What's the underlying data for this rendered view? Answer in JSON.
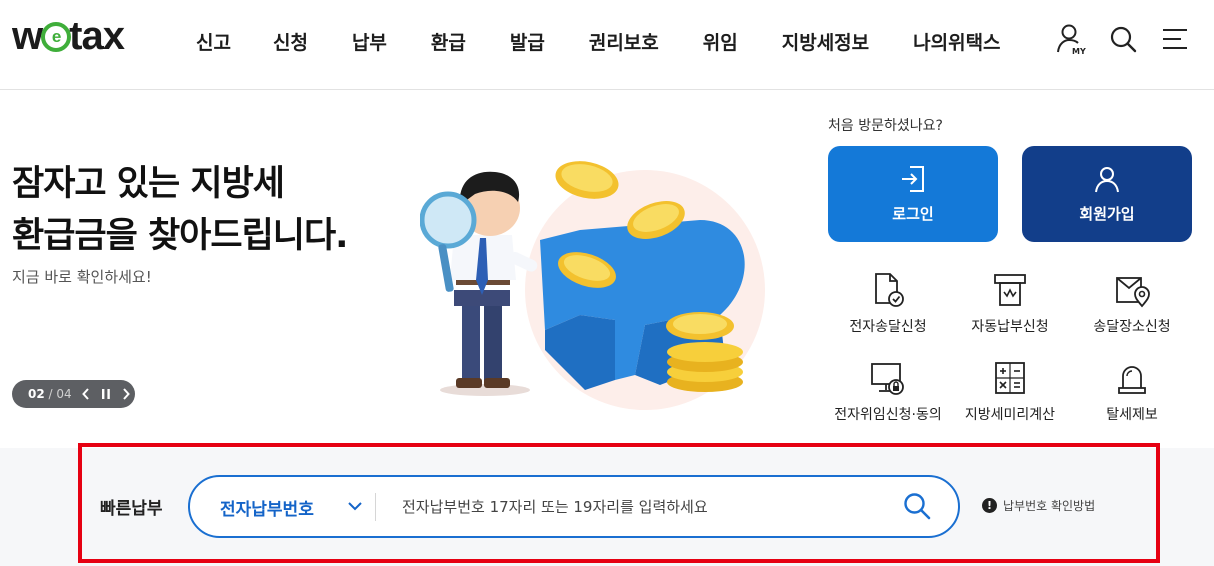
{
  "logo": {
    "pre": "w",
    "mid": "e",
    "post": "tax"
  },
  "nav": [
    "신고",
    "신청",
    "납부",
    "환급",
    "발급",
    "권리보호",
    "위임",
    "지방세정보",
    "나의위택스"
  ],
  "header_icons": [
    "my-page-icon",
    "search-icon",
    "menu-icon"
  ],
  "header_my_label": "MY",
  "hero": {
    "title_line1": "잠자고 있는 지방세",
    "title_line2": "환급금을 찾아드립니다.",
    "subtitle": "지금 바로 확인하세요!",
    "pager_current": "02",
    "pager_separator": "/",
    "pager_total": "04"
  },
  "account": {
    "first_visit": "처음 방문하셨나요?",
    "login": "로그인",
    "join": "회원가입",
    "colors": {
      "login": "#1479d8",
      "join": "#123e8a"
    }
  },
  "services": [
    {
      "label": "전자송달신청",
      "icon": "document-check-icon"
    },
    {
      "label": "자동납부신청",
      "icon": "auto-pay-icon"
    },
    {
      "label": "송달장소신청",
      "icon": "mail-location-icon"
    },
    {
      "label": "전자위임신청·동의",
      "icon": "monitor-lock-icon"
    },
    {
      "label": "지방세미리계산",
      "icon": "calculator-icon"
    },
    {
      "label": "탈세제보",
      "icon": "alarm-bell-icon"
    }
  ],
  "quick_pay": {
    "label": "빠른납부",
    "select_value": "전자납부번호",
    "placeholder": "전자납부번호 17자리 또는 19자리를 입력하세요",
    "help": "납부번호 확인방법",
    "help_mark": "!",
    "accent": "#1a6fd1"
  }
}
